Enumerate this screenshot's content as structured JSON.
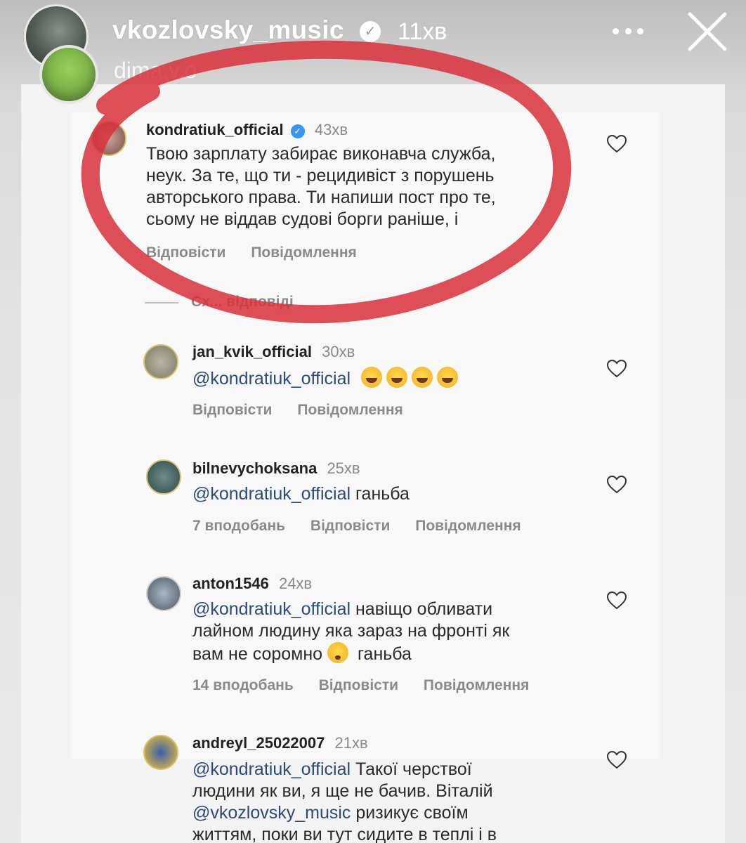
{
  "story": {
    "username": "vkozlovsky_music",
    "time": "11хв",
    "second_user": "dima.v.o"
  },
  "comments": [
    {
      "user": "kondratiuk_official",
      "time": "43хв",
      "lines": [
        "Твою зарплату забирає виконавча служба,",
        "неук. За те, що ти - рецидивіст з порушень",
        "авторського права. Ти напиши пост про те,",
        "сьому не віддав судові борги раніше, і"
      ],
      "reply": "Відповісти",
      "message": "Повідомлення"
    },
    {
      "user": "jan_kvik_official",
      "time": "30хв",
      "mention": "@kondratiuk_official",
      "reply": "Відповісти",
      "message": "Повідомлення"
    },
    {
      "user": "bilnevychoksana",
      "time": "25хв",
      "mention": "@kondratiuk_official",
      "text": " ганьба",
      "likes": "7 вподобань",
      "reply": "Відповісти",
      "message": "Повідомлення"
    },
    {
      "user": "anton1546",
      "time": "24хв",
      "mention": "@kondratiuk_official",
      "line1": " навіщо обливати",
      "line2": "лайном людину яка зараз на фронті як",
      "line3a": "вам не соромно ",
      "line3b": " ганьба",
      "likes": "14 вподобань",
      "reply": "Відповісти",
      "message": "Повідомлення"
    },
    {
      "user": "andreyl_25022007",
      "time": "21хв",
      "mention": "@kondratiuk_official",
      "line1": " Такої черствої",
      "line2": "людини як ви, я ще не бачив. Віталій",
      "mention2": "@vkozlovsky_music",
      "line3": " ризикує своїм",
      "line4": "життям, поки ви тут сидите в теплі і в"
    }
  ],
  "hide_replies": "Сх... відповіді",
  "colors": {
    "annotation": "#d9303a",
    "mention": "#2c4a7a"
  }
}
